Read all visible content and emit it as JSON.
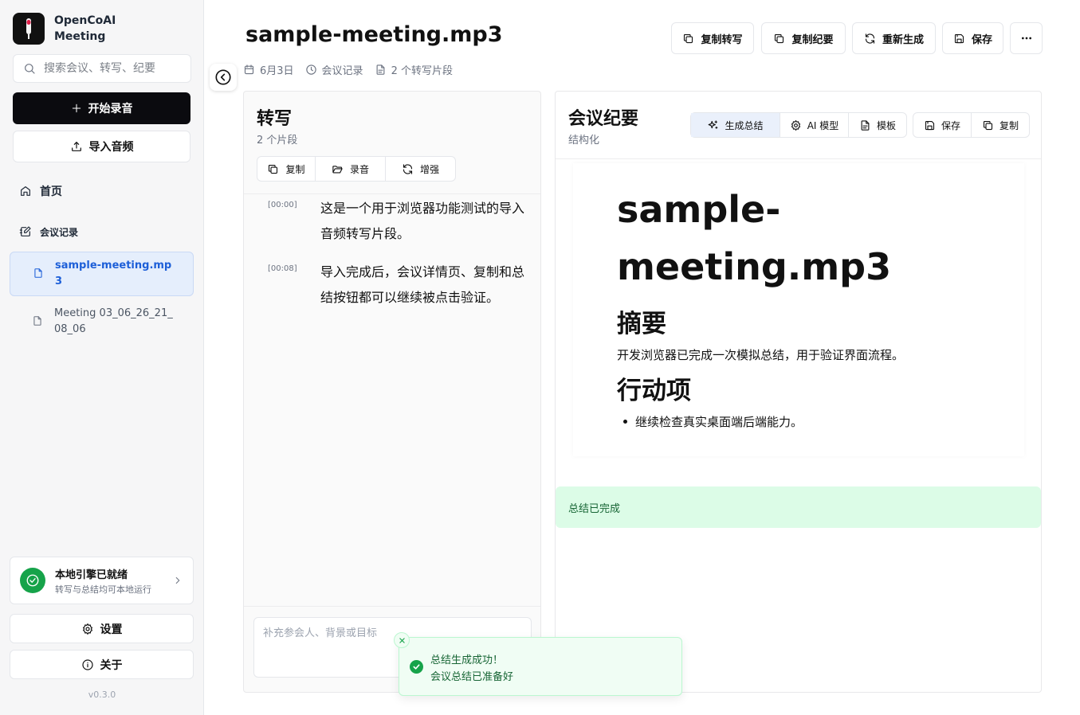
{
  "app": {
    "name_line1": "OpenCoAI",
    "name_line2": "Meeting",
    "version": "v0.3.0"
  },
  "sidebar": {
    "search_placeholder": "搜索会议、转写、纪要",
    "record_label": "开始录音",
    "import_label": "导入音频",
    "home_label": "首页",
    "section_label": "会议记录",
    "meetings": [
      {
        "label": "sample-meeting.mp3",
        "active": true
      },
      {
        "label": "Meeting 03_06_26_21_08_06",
        "active": false
      }
    ],
    "engine_title": "本地引擎已就绪",
    "engine_sub": "转写与总结均可本地运行",
    "settings_label": "设置",
    "about_label": "关于"
  },
  "header": {
    "title": "sample-meeting.mp3",
    "date": "6月3日",
    "category": "会议记录",
    "segments": "2 个转写片段",
    "buttons": {
      "copy_transcript": "复制转写",
      "copy_summary": "复制纪要",
      "regenerate": "重新生成",
      "save": "保存"
    }
  },
  "transcript": {
    "title": "转写",
    "subtitle": "2 个片段",
    "toolbar": {
      "copy": "复制",
      "recording": "录音",
      "enhance": "增强"
    },
    "segments": [
      {
        "time": "[00:00]",
        "text": "这是一个用于浏览器功能测试的导入音频转写片段。"
      },
      {
        "time": "[00:08]",
        "text": "导入完成后，会议详情页、复制和总结按钮都可以继续被点击验证。"
      }
    ],
    "context_placeholder": "补充参会人、背景或目标"
  },
  "summary": {
    "title": "会议纪要",
    "subtitle": "结构化",
    "toolbar": {
      "generate": "生成总结",
      "ai_model": "AI 模型",
      "template": "模板",
      "save": "保存",
      "copy": "复制"
    },
    "doc": {
      "title": "sample-meeting.mp3",
      "h_summary": "摘要",
      "summary_text": "开发浏览器已完成一次模拟总结，用于验证界面流程。",
      "h_actions": "行动项",
      "action_items": [
        "继续检查真实桌面端后端能力。"
      ]
    },
    "status": "总结已完成"
  },
  "toast": {
    "title": "总结生成成功！",
    "description": "会议总结已准备好"
  },
  "colors": {
    "primary_dark": "#0b0b0f",
    "active_blue": "#1d5fd8",
    "success_green": "#16a34a",
    "success_bg": "#dcfce7"
  }
}
